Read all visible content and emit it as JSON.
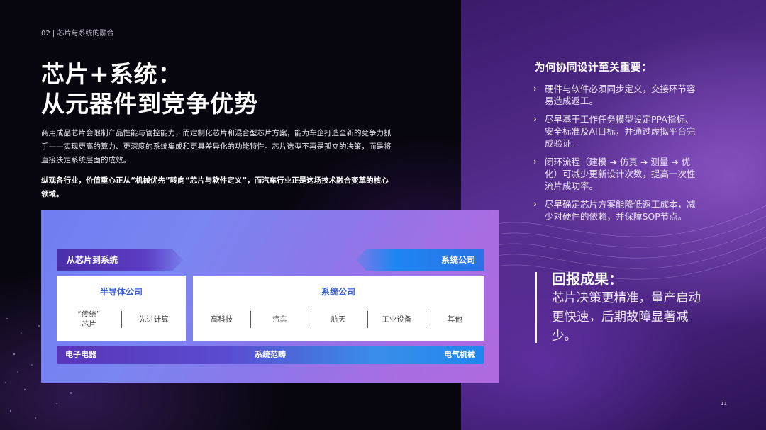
{
  "header": {
    "section_label": "02 | 芯片与系统的融合"
  },
  "title": {
    "line1": "芯片+系统：",
    "line2": "从元器件到竞争优势"
  },
  "paragraphs": {
    "p1": "商用成品芯片会限制产品性能与管控能力，而定制化芯片和混合型芯片方案，能为车企打造全新的竞争力抓手——实现更高的算力、更深度的系统集成和更具差异化的功能特性。芯片选型不再是孤立的决策，而是将直接决定系统层面的成效。",
    "p2": "纵观各行业，价值重心正从“机械优先”转向“芯片与软件定义”，而汽车行业正是这场技术融合变革的核心领域。"
  },
  "diagram": {
    "band_left": "从芯片到系统",
    "band_right": "系统公司",
    "semi_card": {
      "title": "半导体公司",
      "items": [
        "“传统”\n芯片",
        "先进计算"
      ]
    },
    "sys_card": {
      "title": "系统公司",
      "items": [
        "高科技",
        "汽车",
        "航天",
        "工业设备",
        "其他"
      ]
    },
    "bar": {
      "left": "电子电器",
      "middle": "系统范畴",
      "right": "电气机械"
    }
  },
  "why": {
    "title": "为何协同设计至关重要：",
    "bullets": [
      "硬件与软件必须同步定义，交接环节容易造成返工。",
      "尽早基于工作任务模型设定PPA指标、安全标准及AI目标，并通过虚拟平台完成验证。",
      "闭环流程（建模 ➔ 仿真 ➔ 测量 ➔ 优化）可减少更新设计次数，提高一次性流片成功率。",
      "尽早确定芯片方案能降低返工成本，减少对硬件的依赖，并保障SOP节点。"
    ]
  },
  "returns": {
    "title": "回报成果：",
    "text": "芯片决策更精准，量产启动更快速，后期故障显著减少。"
  },
  "footer": {
    "page_number": "11"
  },
  "icons": {
    "bullet": "chevron-right-icon"
  },
  "colors": {
    "accent_blue": "#3b5fd6",
    "panel_purple": "#5a2f93",
    "bar_blue": "#1f86ef"
  }
}
